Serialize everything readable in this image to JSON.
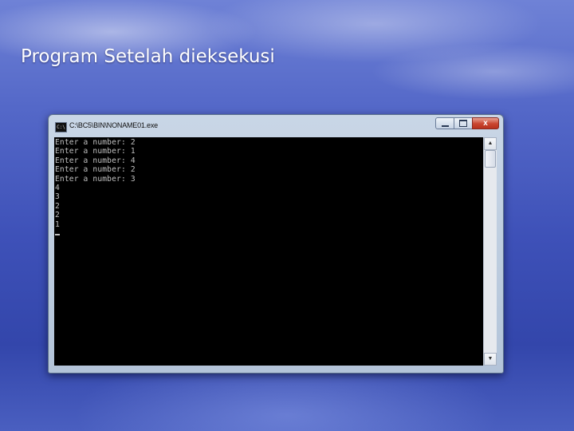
{
  "slide": {
    "title": "Program Setelah dieksekusi"
  },
  "window": {
    "title": "C:\\BC5\\BIN\\NONAME01.exe",
    "icon": "console-app-icon",
    "icon_text": "C:\\",
    "buttons": {
      "minimize": "minimize-icon",
      "maximize": "maximize-icon",
      "close_label": "x"
    }
  },
  "console": {
    "lines": [
      "Enter a number: 2",
      "Enter a number: 1",
      "Enter a number: 4",
      "Enter a number: 2",
      "Enter a number: 3",
      "4",
      "3",
      "2",
      "2",
      "1"
    ],
    "text_color": "#c0c0c0",
    "background": "#000000"
  },
  "scrollbar": {
    "up_arrow": "▲",
    "down_arrow": "▼"
  }
}
